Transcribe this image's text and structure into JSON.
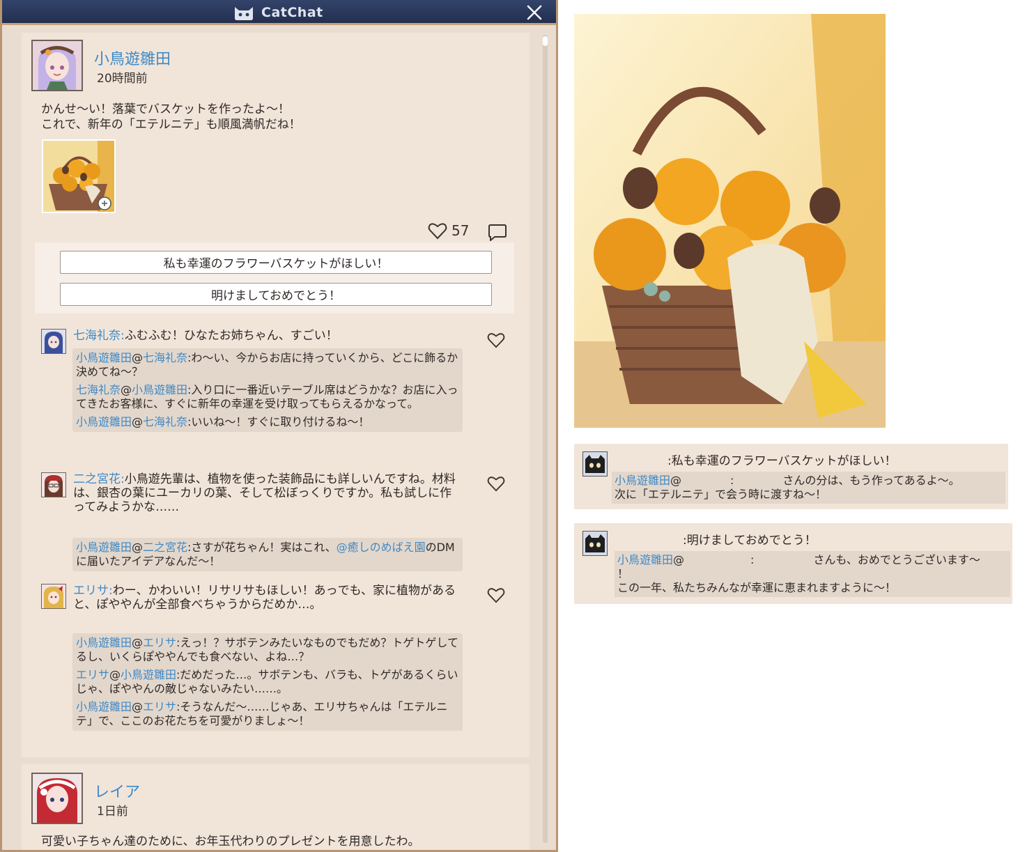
{
  "app": {
    "title": "CatChat"
  },
  "post1": {
    "author": "小鳥遊雛田",
    "time": "20時間前",
    "body": "かんせ〜い！落葉でバスケットを作ったよ〜！\nこれで、新年の「エテルニテ」も順風満帆だね！",
    "likes": "57",
    "reply_options": [
      "私も幸運のフラワーバスケットがほしい！",
      "明けましておめでとう！"
    ],
    "comments": [
      {
        "name": "七海礼奈:",
        "text": "ふむふむ！ひなたお姉ちゃん、すごい！",
        "thread": [
          {
            "who": "小鳥遊雛田",
            "at": "七海礼奈",
            "text": "わ〜い、今からお店に持っていくから、どこに飾るか決めてね〜？"
          },
          {
            "who": "七海礼奈",
            "at": "小鳥遊雛田",
            "text": "入り口に一番近いテーブル席はどうかな？お店に入ってきたお客様に、すぐに新年の幸運を受け取ってもらえるかなって。"
          },
          {
            "who": "小鳥遊雛田",
            "at": "七海礼奈",
            "text": "いいね〜！すぐに取り付けるね〜！"
          }
        ]
      },
      {
        "name": "二之宮花:",
        "text": "小鳥遊先輩は、植物を使った装飾品にも詳しいんですね。材料は、銀杏の葉にユーカリの葉、そして松ぼっくりですか。私も試しに作ってみようかな……",
        "thread": [
          {
            "who": "小鳥遊雛田",
            "at": "二之宮花",
            "text": "さすが花ちゃん！実はこれ、",
            "mention": "@癒しのめばえ園",
            "after": "のDMに届いたアイデアなんだ〜！"
          }
        ]
      },
      {
        "name": "エリサ:",
        "text": "わー、かわいい！リサリサもほしい！あっでも、家に植物があると、ぽややんが全部食べちゃうからだめか…。",
        "thread": [
          {
            "who": "小鳥遊雛田",
            "at": "エリサ",
            "text": "えっ！？サボテンみたいなものでもだめ？トゲトゲしてるし、いくらぽややんでも食べない、よね…？"
          },
          {
            "who": "エリサ",
            "at": "小鳥遊雛田",
            "text": "だめだった…。サボテンも、バラも、トゲがあるくらいじゃ、ぽややんの敵じゃないみたい……。"
          },
          {
            "who": "小鳥遊雛田",
            "at": "エリサ",
            "text": "そうなんだ〜……じゃあ、エリサちゃんは「エテルニテ」で、ここのお花たちを可愛がりましょ〜！"
          }
        ]
      }
    ]
  },
  "post2": {
    "author": "レイア",
    "time": "1日前",
    "body": "可愛い子ちゃん達のために、お年玉代わりのプレゼントを用意したわ。"
  },
  "reply_cards": [
    {
      "title": ":私も幸運のフラワーバスケットがほしい！",
      "reply_who": "小鳥遊雛田",
      "reply_at": "@",
      "reply_colon": ":",
      "reply_text": "さんの分は、もう作ってあるよ〜。",
      "reply_text2": "次に「エテルニテ」で会う時に渡すね〜！"
    },
    {
      "title": ":明けましておめでとう！",
      "reply_who": "小鳥遊雛田",
      "reply_at": "@",
      "reply_colon": ":",
      "reply_text": "さんも、おめでとうございます〜",
      "reply_text2": "！",
      "reply_text3": "この一年、私たちみんなが幸運に恵まれますように〜！"
    }
  ],
  "colors": {
    "name_blue": "#3e89c5",
    "titlebar": "#2a3658",
    "frame": "#b9956f",
    "card": "#f1e5da"
  },
  "icons": [
    "cat-logo-icon",
    "close-icon",
    "heart-icon",
    "comment-icon",
    "zoom-icon"
  ]
}
